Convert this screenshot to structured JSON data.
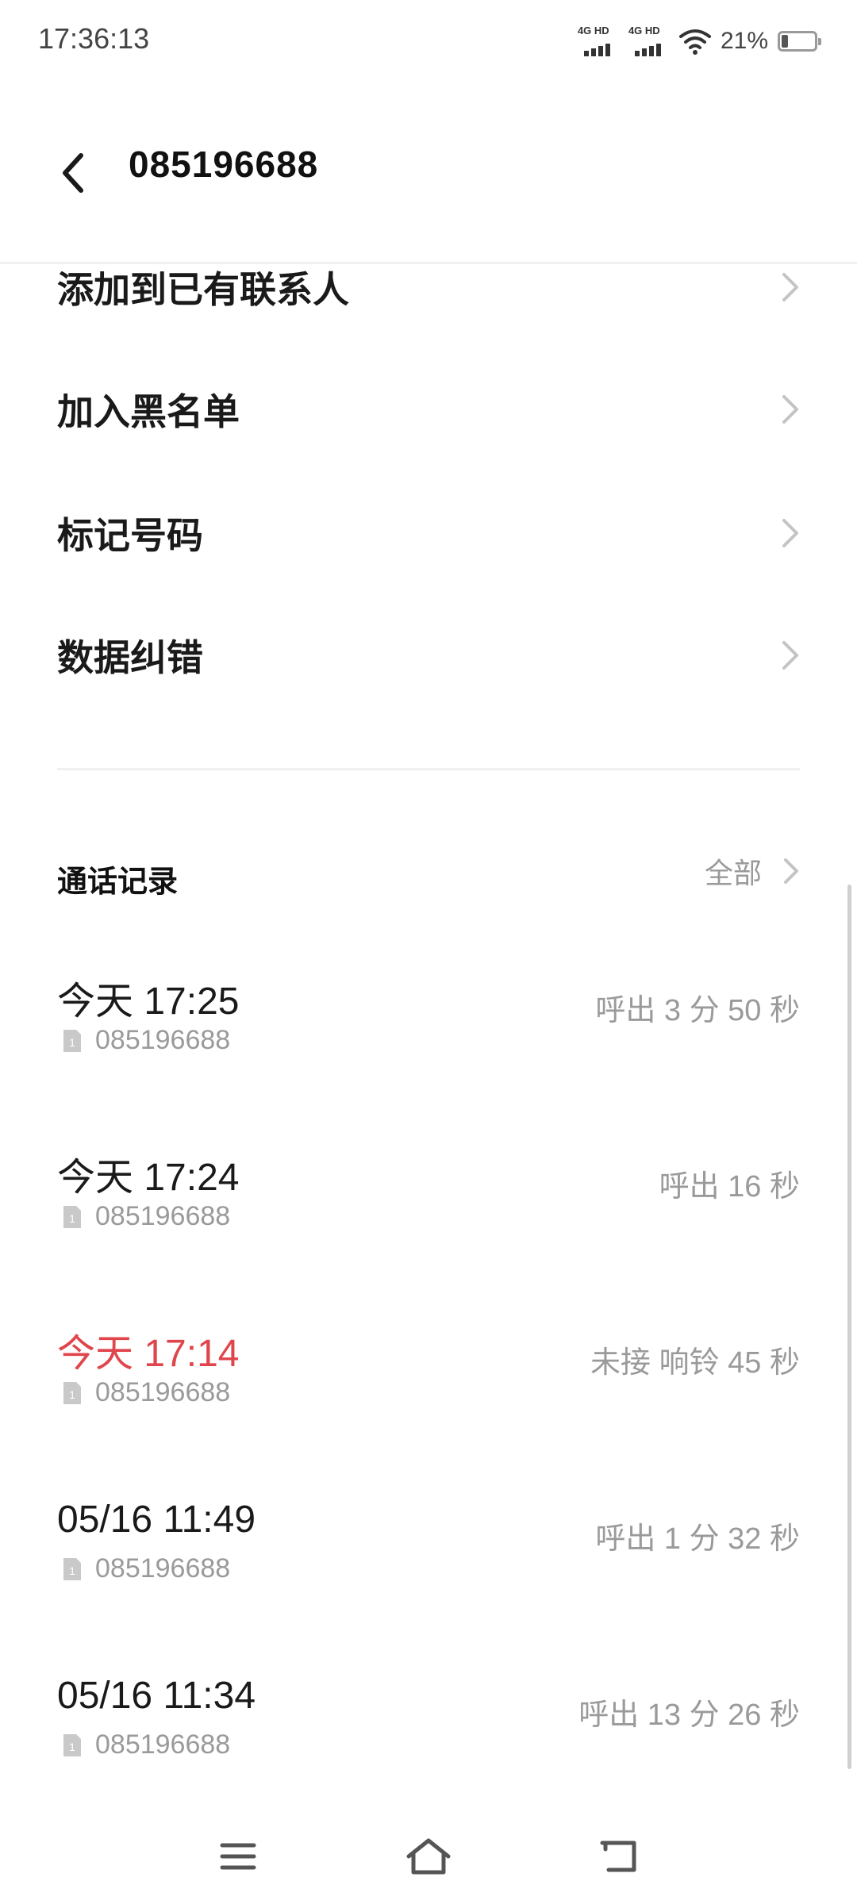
{
  "status_bar": {
    "time": "17:36:13",
    "signal1_label": "4G HD",
    "signal2_label": "4G HD",
    "battery_percent": "21%",
    "battery_level": 0.21
  },
  "header": {
    "title": "085196688",
    "back_icon": "chevron-left-icon"
  },
  "menu": {
    "items": [
      {
        "label": "添加到已有联系人",
        "icon": "chevron-right-icon"
      },
      {
        "label": "加入黑名单",
        "icon": "chevron-right-icon"
      },
      {
        "label": "标记号码",
        "icon": "chevron-right-icon"
      },
      {
        "label": "数据纠错",
        "icon": "chevron-right-icon"
      }
    ]
  },
  "call_log": {
    "title": "通话记录",
    "all_label": "全部",
    "entries": [
      {
        "time": "今天 17:25",
        "number": "085196688",
        "detail": "呼出 3 分 50 秒",
        "missed": false
      },
      {
        "time": "今天 17:24",
        "number": "085196688",
        "detail": "呼出 16 秒",
        "missed": false
      },
      {
        "time": "今天 17:14",
        "number": "085196688",
        "detail": "未接 响铃 45 秒",
        "missed": true
      },
      {
        "time": "05/16 11:49",
        "number": "085196688",
        "detail": "呼出 1 分 32 秒",
        "missed": false
      },
      {
        "time": "05/16 11:34",
        "number": "085196688",
        "detail": "呼出 13 分 26 秒",
        "missed": false
      }
    ]
  },
  "colors": {
    "missed": "#e0454b",
    "secondary_text": "#9a9a9a",
    "primary_text": "#1a1a1a"
  },
  "nav_bar": {
    "menu_icon": "menu-icon",
    "home_icon": "home-icon",
    "back_icon": "back-arrow-icon"
  }
}
